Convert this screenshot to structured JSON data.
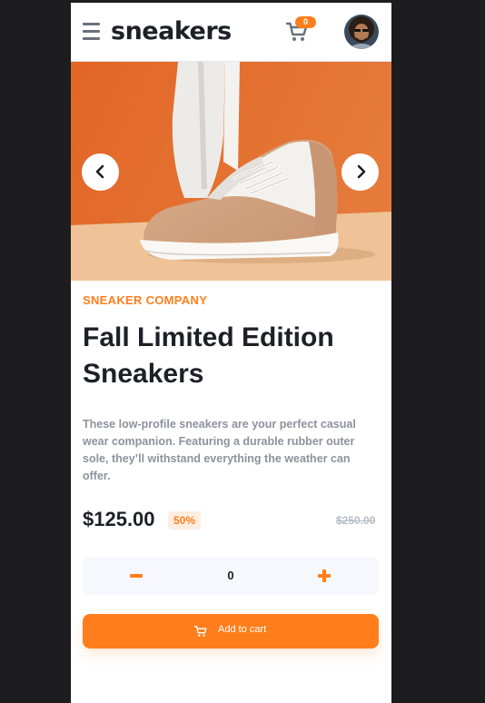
{
  "header": {
    "logo": "sneakers",
    "cart_count": "0",
    "menu_icon": "hamburger-menu-icon",
    "cart_icon": "shopping-cart-icon"
  },
  "gallery": {
    "prev_icon": "chevron-left-icon",
    "next_icon": "chevron-right-icon"
  },
  "product": {
    "company": "SNEAKER COMPANY",
    "title": "Fall Limited Edition Sneakers",
    "description": "These low-profile sneakers are your perfect casual wear companion. Featuring a durable rubber outer sole, they’ll withstand everything the weather can offer.",
    "price": "$125.00",
    "discount": "50%",
    "original_price": "$250.00"
  },
  "quantity": {
    "value": "0"
  },
  "actions": {
    "add_to_cart": "Add to cart"
  },
  "colors": {
    "accent": "#ff7e1b",
    "accent_soft": "#ffede0",
    "text_dark": "#1d2026",
    "text_muted": "#8c929d",
    "hero_background": "#e5702a"
  }
}
